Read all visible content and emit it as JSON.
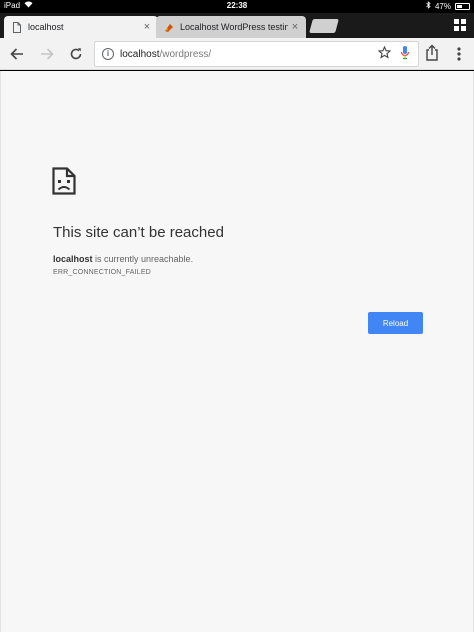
{
  "status_bar": {
    "device": "iPad",
    "time": "22:38",
    "battery": "47%",
    "battery_level": 0.47
  },
  "tabs": [
    {
      "title": "localhost",
      "icon": "page-icon",
      "close": "×"
    },
    {
      "title": "Localhost WordPress testin",
      "icon": "wordpress-favicon",
      "close": "×"
    }
  ],
  "toolbar": {
    "url_host": "localhost",
    "url_path": "/wordpress/"
  },
  "error_page": {
    "title": "This site can’t be reached",
    "host": "localhost",
    "description": " is currently unreachable.",
    "error_code": "ERR_CONNECTION_FAILED",
    "reload_label": "Reload"
  },
  "colors": {
    "accent": "#4285f4",
    "page_background": "#f7f7f7",
    "tab_strip": "#1a1a1a"
  }
}
